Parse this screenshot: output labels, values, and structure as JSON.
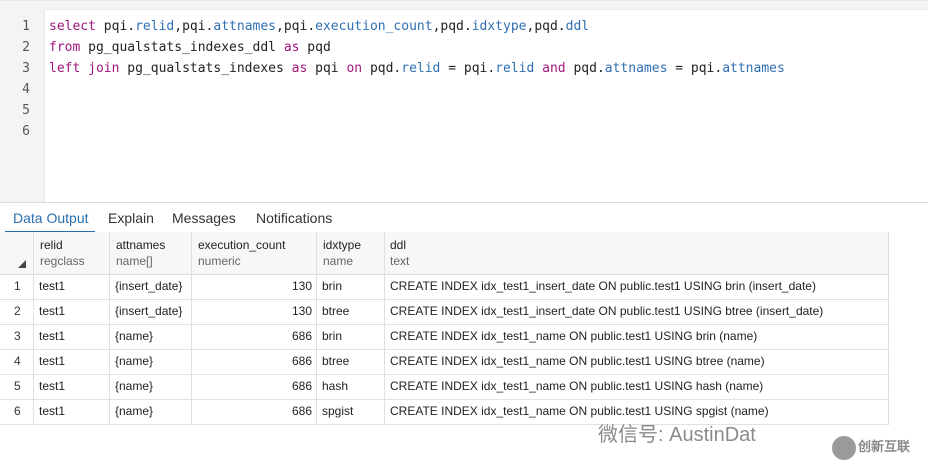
{
  "editor": {
    "line_numbers": [
      "1",
      "2",
      "3",
      "4",
      "5",
      "6"
    ],
    "line1": {
      "t1": "select ",
      "t2": "pqi.",
      "t3": "relid",
      ",": ",",
      "t4": "pqi.",
      "t5": "attnames",
      "t6": ",pqi.",
      "t7": "execution_count",
      "t8": ",pqd.",
      "t9": "idxtype",
      "t10": ",pqd.",
      "t11": "ddl"
    },
    "line2": {
      "t1": "from ",
      "t2": "pg_qualstats_indexes_ddl ",
      "t3": "as ",
      "t4": "pqd"
    },
    "line3": {
      "t1": "left join ",
      "t2": "pg_qualstats_indexes ",
      "t3": "as ",
      "t4": "pqi ",
      "t5": "on ",
      "t6": "pqd.",
      "t7": "relid",
      " ": " = pqi.",
      "t8": "relid",
      "t9": " and ",
      "t10": "pqd.",
      "t11": "attnames",
      "t12": " = pqi.",
      "t13": "attnames"
    }
  },
  "tabs": [
    "Data Output",
    "Explain",
    "Messages",
    "Notifications"
  ],
  "grid": {
    "columns": [
      {
        "name": "relid",
        "type": "regclass"
      },
      {
        "name": "attnames",
        "type": "name[]"
      },
      {
        "name": "execution_count",
        "type": "numeric"
      },
      {
        "name": "idxtype",
        "type": "name"
      },
      {
        "name": "ddl",
        "type": "text"
      }
    ],
    "rows": [
      {
        "n": "1",
        "relid": "test1",
        "attnames": "{insert_date}",
        "execution_count": "130",
        "idxtype": "brin",
        "ddl": "CREATE INDEX idx_test1_insert_date ON public.test1 USING brin (insert_date)"
      },
      {
        "n": "2",
        "relid": "test1",
        "attnames": "{insert_date}",
        "execution_count": "130",
        "idxtype": "btree",
        "ddl": "CREATE INDEX idx_test1_insert_date ON public.test1 USING btree (insert_date)"
      },
      {
        "n": "3",
        "relid": "test1",
        "attnames": "{name}",
        "execution_count": "686",
        "idxtype": "brin",
        "ddl": "CREATE INDEX idx_test1_name ON public.test1 USING brin (name)"
      },
      {
        "n": "4",
        "relid": "test1",
        "attnames": "{name}",
        "execution_count": "686",
        "idxtype": "btree",
        "ddl": "CREATE INDEX idx_test1_name ON public.test1 USING btree (name)"
      },
      {
        "n": "5",
        "relid": "test1",
        "attnames": "{name}",
        "execution_count": "686",
        "idxtype": "hash",
        "ddl": "CREATE INDEX idx_test1_name ON public.test1 USING hash (name)"
      },
      {
        "n": "6",
        "relid": "test1",
        "attnames": "{name}",
        "execution_count": "686",
        "idxtype": "spgist",
        "ddl": "CREATE INDEX idx_test1_name ON public.test1 USING spgist (name)"
      }
    ]
  },
  "watermark": {
    "text": "微信号: AustinDat",
    "brand": "创新互联"
  }
}
